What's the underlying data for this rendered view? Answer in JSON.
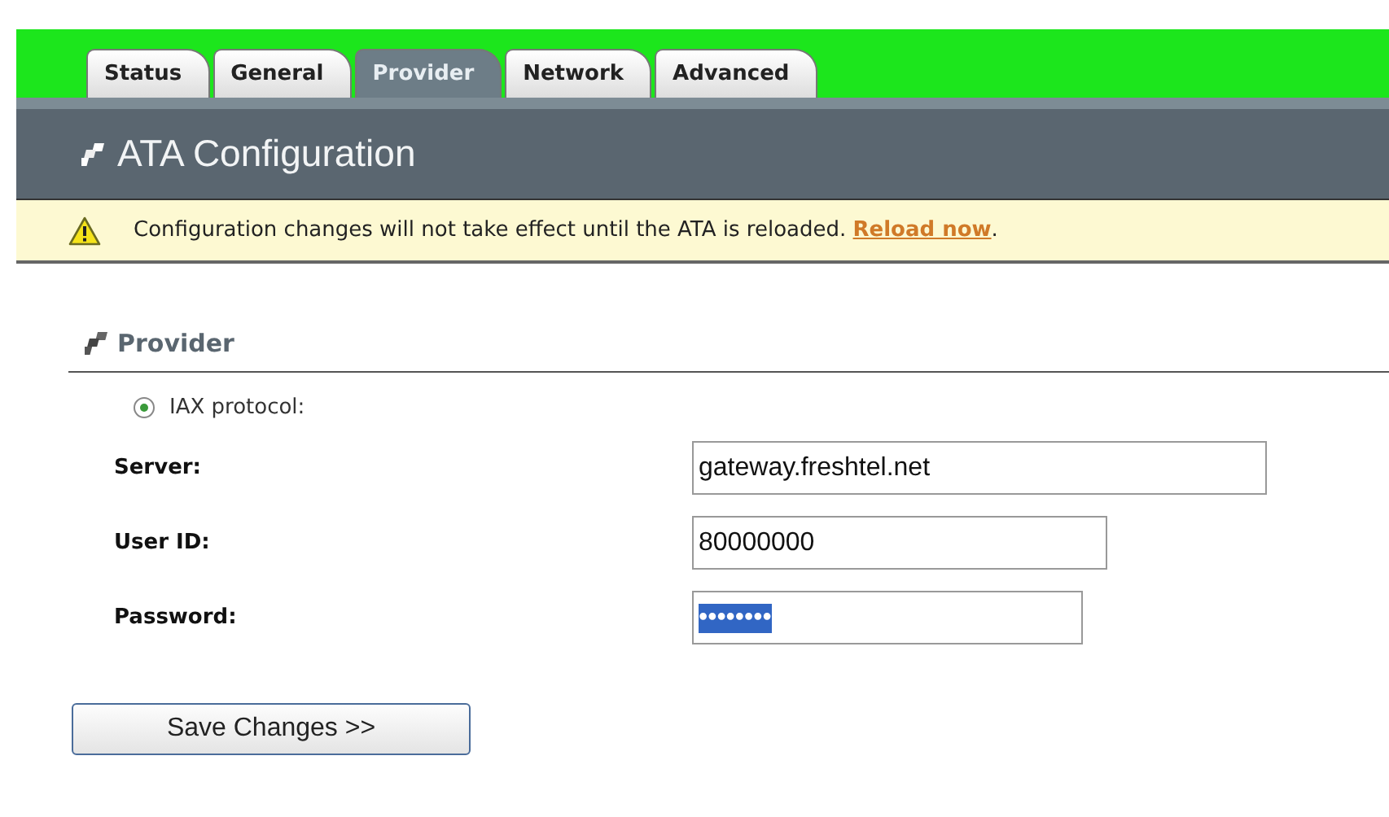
{
  "tabs": [
    {
      "label": "Status",
      "selected": false
    },
    {
      "label": "General",
      "selected": false
    },
    {
      "label": "Provider",
      "selected": true
    },
    {
      "label": "Network",
      "selected": false
    },
    {
      "label": "Advanced",
      "selected": false
    }
  ],
  "header": {
    "title": "ATA Configuration"
  },
  "notice": {
    "text": "Configuration changes will not take effect until the ATA is reloaded.",
    "link": "Reload now",
    "trailing": "."
  },
  "section": {
    "title": "Provider"
  },
  "protocol": {
    "label": "IAX protocol:",
    "selected": true
  },
  "fields": [
    {
      "label": "Server:",
      "value": "gateway.freshtel.net",
      "highlighted": false
    },
    {
      "label": "User ID:",
      "value": "80000000",
      "highlighted": false
    },
    {
      "label": "Password:",
      "value": "••••••••",
      "highlighted": true
    }
  ],
  "save_button": "Save Changes >>"
}
